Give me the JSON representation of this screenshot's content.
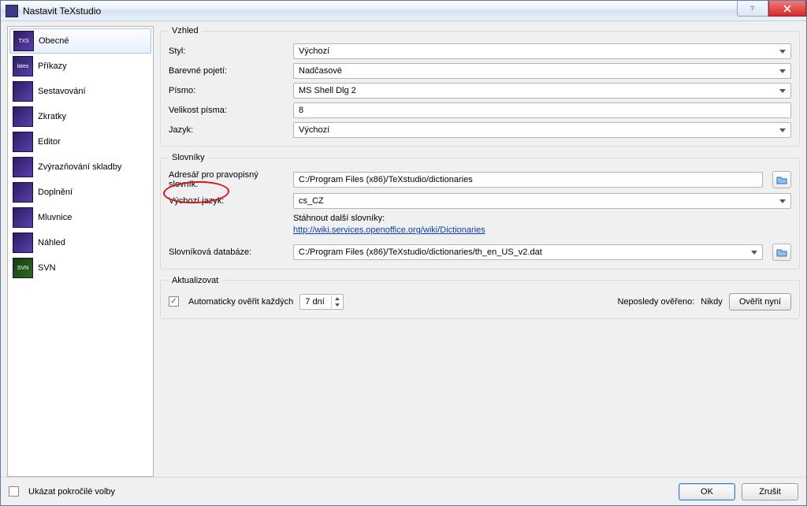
{
  "window": {
    "title": "Nastavit TeXstudio"
  },
  "sidebar": {
    "items": [
      {
        "label": "Obecné",
        "icon": "TXS"
      },
      {
        "label": "Příkazy",
        "icon": "latex"
      },
      {
        "label": "Sestavování",
        "icon": ""
      },
      {
        "label": "Zkratky",
        "icon": ""
      },
      {
        "label": "Editor",
        "icon": ""
      },
      {
        "label": "Zvýrazňování skladby",
        "icon": ""
      },
      {
        "label": "Doplnění",
        "icon": ""
      },
      {
        "label": "Mluvnice",
        "icon": ""
      },
      {
        "label": "Náhled",
        "icon": ""
      },
      {
        "label": "SVN",
        "icon": "SVN"
      }
    ],
    "selectedIndex": 0
  },
  "sections": {
    "appearance": "Vzhled",
    "dictionaries": "Slovníky",
    "update": "Aktualizovat"
  },
  "appearance": {
    "style_label": "Styl:",
    "style_value": "Výchozí",
    "color_label": "Barevné pojetí:",
    "color_value": "Nadčasové",
    "font_label": "Písmo:",
    "font_value": "MS Shell Dlg 2",
    "fontsize_label": "Velikost písma:",
    "fontsize_value": "8",
    "lang_label": "Jazyk:",
    "lang_value": "Výchozí"
  },
  "dictionaries": {
    "dir_label": "Adresář pro pravopisný slovník:",
    "dir_value": "C:/Program Files (x86)/TeXstudio/dictionaries",
    "deflang_label": "Výchozí jazyk:",
    "deflang_value": "cs_CZ",
    "download_label": "Stáhnout další slovníky:",
    "download_link": "http://wiki.services.openoffice.org/wiki/Dictionaries",
    "db_label": "Slovníková databáze:",
    "db_value": "C:/Program Files (x86)/TeXstudio/dictionaries/th_en_US_v2.dat"
  },
  "update": {
    "auto_label": "Automaticky ověřit každých",
    "interval": "7 dní",
    "last_label": "Neposledy ověřeno:",
    "last_value": "Nikdy",
    "check_btn": "Ověřit nyní"
  },
  "footer": {
    "advanced": "Ukázat pokročilé volby",
    "ok": "OK",
    "cancel": "Zrušit"
  }
}
